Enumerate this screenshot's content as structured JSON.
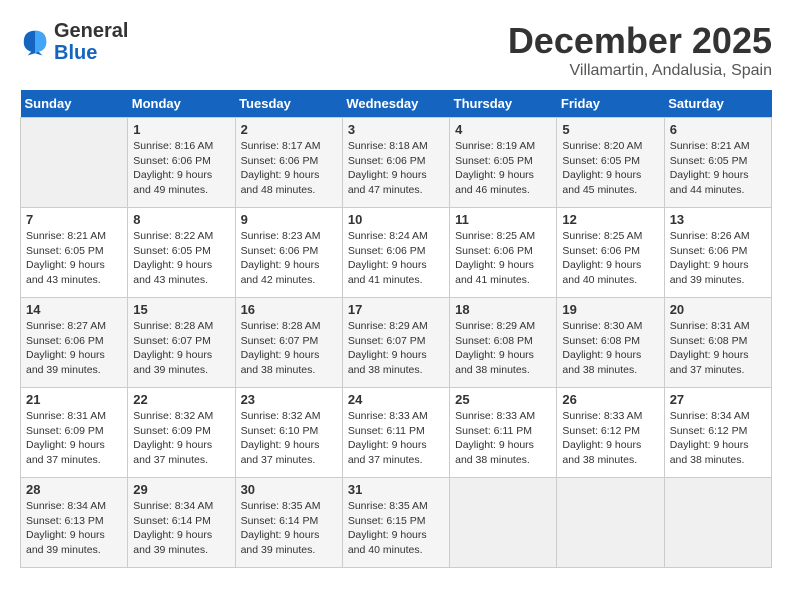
{
  "logo": {
    "line1": "General",
    "line2": "Blue"
  },
  "title": "December 2025",
  "location": "Villamartin, Andalusia, Spain",
  "weekdays": [
    "Sunday",
    "Monday",
    "Tuesday",
    "Wednesday",
    "Thursday",
    "Friday",
    "Saturday"
  ],
  "weeks": [
    [
      {
        "day": "",
        "empty": true
      },
      {
        "day": "1",
        "sunrise": "8:16 AM",
        "sunset": "6:06 PM",
        "daylight": "9 hours and 49 minutes."
      },
      {
        "day": "2",
        "sunrise": "8:17 AM",
        "sunset": "6:06 PM",
        "daylight": "9 hours and 48 minutes."
      },
      {
        "day": "3",
        "sunrise": "8:18 AM",
        "sunset": "6:06 PM",
        "daylight": "9 hours and 47 minutes."
      },
      {
        "day": "4",
        "sunrise": "8:19 AM",
        "sunset": "6:05 PM",
        "daylight": "9 hours and 46 minutes."
      },
      {
        "day": "5",
        "sunrise": "8:20 AM",
        "sunset": "6:05 PM",
        "daylight": "9 hours and 45 minutes."
      },
      {
        "day": "6",
        "sunrise": "8:21 AM",
        "sunset": "6:05 PM",
        "daylight": "9 hours and 44 minutes."
      }
    ],
    [
      {
        "day": "7",
        "sunrise": "8:21 AM",
        "sunset": "6:05 PM",
        "daylight": "9 hours and 43 minutes."
      },
      {
        "day": "8",
        "sunrise": "8:22 AM",
        "sunset": "6:05 PM",
        "daylight": "9 hours and 43 minutes."
      },
      {
        "day": "9",
        "sunrise": "8:23 AM",
        "sunset": "6:06 PM",
        "daylight": "9 hours and 42 minutes."
      },
      {
        "day": "10",
        "sunrise": "8:24 AM",
        "sunset": "6:06 PM",
        "daylight": "9 hours and 41 minutes."
      },
      {
        "day": "11",
        "sunrise": "8:25 AM",
        "sunset": "6:06 PM",
        "daylight": "9 hours and 41 minutes."
      },
      {
        "day": "12",
        "sunrise": "8:25 AM",
        "sunset": "6:06 PM",
        "daylight": "9 hours and 40 minutes."
      },
      {
        "day": "13",
        "sunrise": "8:26 AM",
        "sunset": "6:06 PM",
        "daylight": "9 hours and 39 minutes."
      }
    ],
    [
      {
        "day": "14",
        "sunrise": "8:27 AM",
        "sunset": "6:06 PM",
        "daylight": "9 hours and 39 minutes."
      },
      {
        "day": "15",
        "sunrise": "8:28 AM",
        "sunset": "6:07 PM",
        "daylight": "9 hours and 39 minutes."
      },
      {
        "day": "16",
        "sunrise": "8:28 AM",
        "sunset": "6:07 PM",
        "daylight": "9 hours and 38 minutes."
      },
      {
        "day": "17",
        "sunrise": "8:29 AM",
        "sunset": "6:07 PM",
        "daylight": "9 hours and 38 minutes."
      },
      {
        "day": "18",
        "sunrise": "8:29 AM",
        "sunset": "6:08 PM",
        "daylight": "9 hours and 38 minutes."
      },
      {
        "day": "19",
        "sunrise": "8:30 AM",
        "sunset": "6:08 PM",
        "daylight": "9 hours and 38 minutes."
      },
      {
        "day": "20",
        "sunrise": "8:31 AM",
        "sunset": "6:08 PM",
        "daylight": "9 hours and 37 minutes."
      }
    ],
    [
      {
        "day": "21",
        "sunrise": "8:31 AM",
        "sunset": "6:09 PM",
        "daylight": "9 hours and 37 minutes."
      },
      {
        "day": "22",
        "sunrise": "8:32 AM",
        "sunset": "6:09 PM",
        "daylight": "9 hours and 37 minutes."
      },
      {
        "day": "23",
        "sunrise": "8:32 AM",
        "sunset": "6:10 PM",
        "daylight": "9 hours and 37 minutes."
      },
      {
        "day": "24",
        "sunrise": "8:33 AM",
        "sunset": "6:11 PM",
        "daylight": "9 hours and 37 minutes."
      },
      {
        "day": "25",
        "sunrise": "8:33 AM",
        "sunset": "6:11 PM",
        "daylight": "9 hours and 38 minutes."
      },
      {
        "day": "26",
        "sunrise": "8:33 AM",
        "sunset": "6:12 PM",
        "daylight": "9 hours and 38 minutes."
      },
      {
        "day": "27",
        "sunrise": "8:34 AM",
        "sunset": "6:12 PM",
        "daylight": "9 hours and 38 minutes."
      }
    ],
    [
      {
        "day": "28",
        "sunrise": "8:34 AM",
        "sunset": "6:13 PM",
        "daylight": "9 hours and 39 minutes."
      },
      {
        "day": "29",
        "sunrise": "8:34 AM",
        "sunset": "6:14 PM",
        "daylight": "9 hours and 39 minutes."
      },
      {
        "day": "30",
        "sunrise": "8:35 AM",
        "sunset": "6:14 PM",
        "daylight": "9 hours and 39 minutes."
      },
      {
        "day": "31",
        "sunrise": "8:35 AM",
        "sunset": "6:15 PM",
        "daylight": "9 hours and 40 minutes."
      },
      {
        "day": "",
        "empty": true
      },
      {
        "day": "",
        "empty": true
      },
      {
        "day": "",
        "empty": true
      }
    ]
  ],
  "labels": {
    "sunrise": "Sunrise:",
    "sunset": "Sunset:",
    "daylight": "Daylight:"
  }
}
